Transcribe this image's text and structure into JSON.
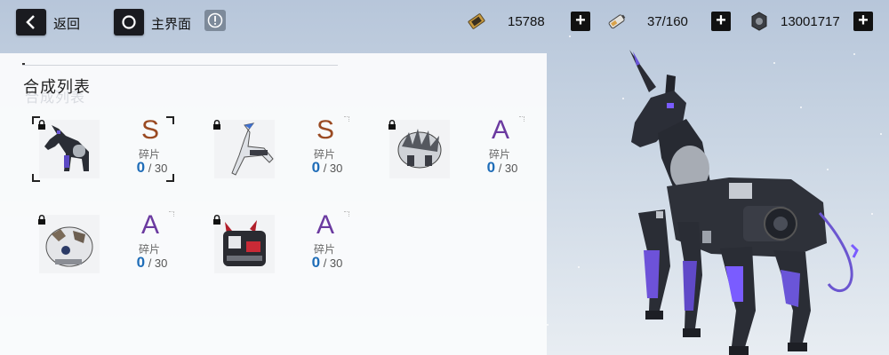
{
  "topbar": {
    "back_label": "返回",
    "home_label": "主界面",
    "resources": [
      {
        "icon": "ticket-icon",
        "value": "15788"
      },
      {
        "icon": "battery-icon",
        "value": "37/160"
      },
      {
        "icon": "gear-coin-icon",
        "value": "13001717"
      }
    ]
  },
  "panel": {
    "title": "合成列表",
    "fragment_label": "碎片",
    "items": [
      {
        "grade": "S",
        "current": "0",
        "total": "/ 30",
        "selected": true,
        "icon": "robot-unicorn-thumb"
      },
      {
        "grade": "S",
        "current": "0",
        "total": "/ 30",
        "selected": false,
        "icon": "robot-crane-thumb"
      },
      {
        "grade": "A",
        "current": "0",
        "total": "/ 30",
        "selected": false,
        "icon": "robot-hedgehog-thumb"
      },
      {
        "grade": "A",
        "current": "0",
        "total": "/ 30",
        "selected": false,
        "icon": "robot-beast-thumb"
      },
      {
        "grade": "A",
        "current": "0",
        "total": "/ 30",
        "selected": false,
        "icon": "robot-bull-thumb"
      }
    ]
  },
  "colors": {
    "grade_s": "#9a4a22",
    "grade_a": "#6b3aa0",
    "count_current": "#1f6db8",
    "unicorn_glow": "#7a5cff"
  }
}
